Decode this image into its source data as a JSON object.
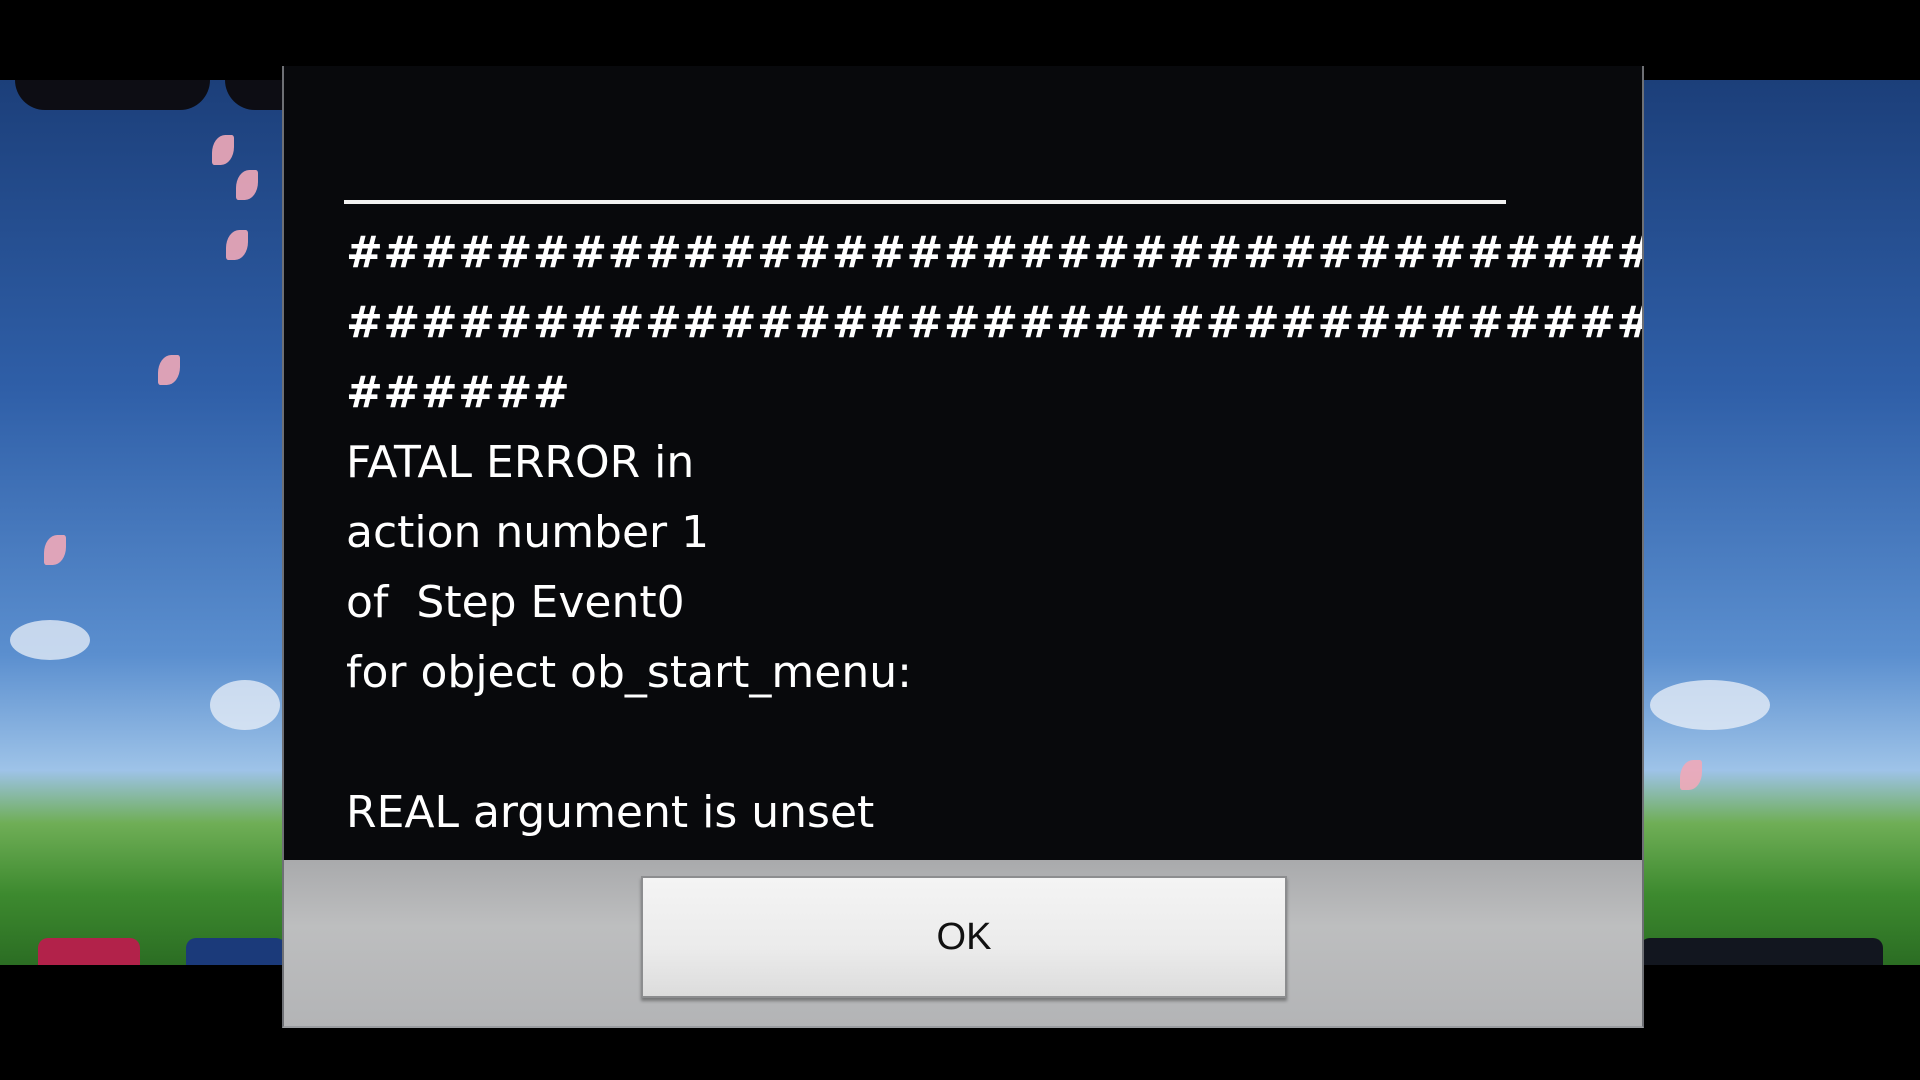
{
  "dialog": {
    "message_lines": [
      "############################################",
      "############################################",
      "######",
      "FATAL ERROR in",
      "action number 1",
      "of  Step Event0",
      "for object ob_start_menu:",
      "",
      "REAL argument is unset"
    ],
    "ok_label": "OK"
  },
  "colors": {
    "dialog_background": "#08090c",
    "button_bar": "#b5b6b8",
    "text": "#ffffff"
  }
}
